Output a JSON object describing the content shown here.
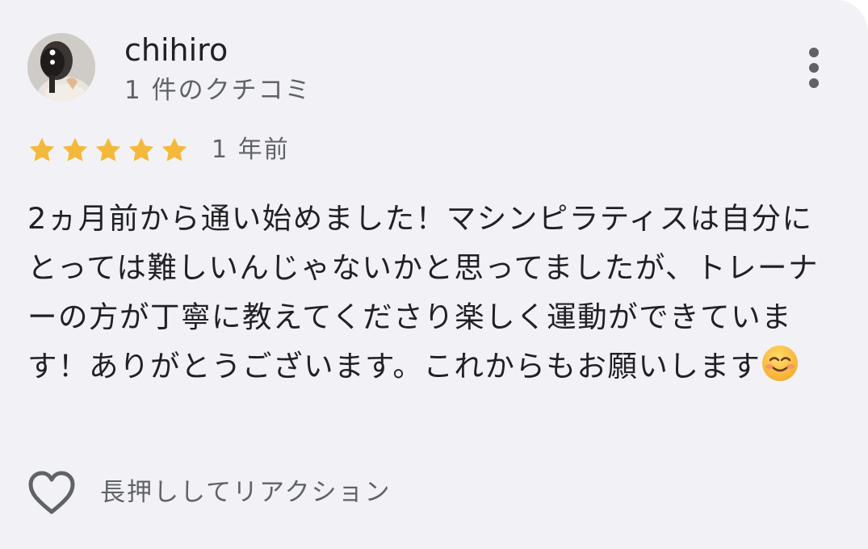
{
  "reviewer": {
    "name": "chihiro",
    "review_count": "1 件のクチコミ",
    "avatar_icon": "profile-photo"
  },
  "review": {
    "rating": 5,
    "rating_max": 5,
    "time_ago": "1 年前",
    "text": "2ヵ月前から通い始めました！マシンピラティスは自分にとっては難しいんじゃないかと思ってましたが、トレーナーの方が丁寧に教えてくださり楽しく運動ができています！ありがとうございます。これからもお願いします",
    "emoji": "☺️"
  },
  "actions": {
    "more_icon": "more-vert-icon",
    "heart_icon": "heart-outline-icon",
    "reaction_hint": "長押ししてリアクション"
  },
  "colors": {
    "card_background": "#f2f2f6",
    "star": "#f4b83b",
    "primary_text": "#202124",
    "secondary_text": "#5f6368",
    "icon": "#5f6368"
  }
}
